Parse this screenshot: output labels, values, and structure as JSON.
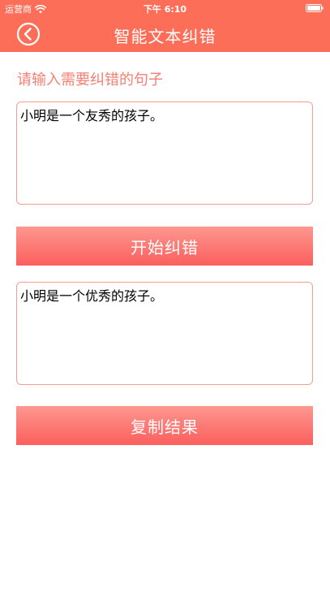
{
  "status_bar": {
    "carrier": "运营商",
    "time": "下午 6:10"
  },
  "nav": {
    "title": "智能文本纠错"
  },
  "prompt": "请输入需要纠错的句子",
  "input": {
    "value": "小明是一个友秀的孩子。"
  },
  "correct_button_label": "开始纠错",
  "output": {
    "value": "小明是一个优秀的孩子。"
  },
  "copy_button_label": "复制结果",
  "colors": {
    "header": "#fd6e58",
    "accent_text": "#f47f72",
    "border": "#f59d94",
    "button_top": "#fd9890",
    "button_bottom": "#fb5f5e"
  },
  "icons": {
    "back": "back-chevron-circle-icon",
    "wifi": "wifi-icon",
    "battery": "battery-icon"
  }
}
